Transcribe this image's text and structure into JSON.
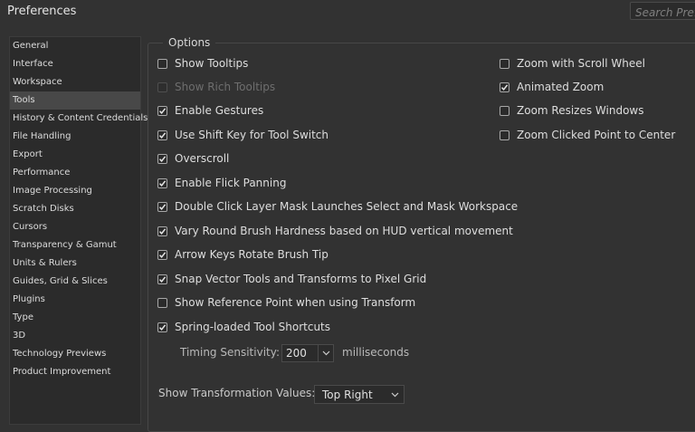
{
  "window": {
    "title": "Preferences"
  },
  "search": {
    "placeholder": "Search Preferences"
  },
  "sidebar": {
    "items": [
      {
        "label": "General"
      },
      {
        "label": "Interface"
      },
      {
        "label": "Workspace"
      },
      {
        "label": "Tools",
        "selected": true
      },
      {
        "label": "History & Content Credentials"
      },
      {
        "label": "File Handling"
      },
      {
        "label": "Export"
      },
      {
        "label": "Performance"
      },
      {
        "label": "Image Processing"
      },
      {
        "label": "Scratch Disks"
      },
      {
        "label": "Cursors"
      },
      {
        "label": "Transparency & Gamut"
      },
      {
        "label": "Units & Rulers"
      },
      {
        "label": "Guides, Grid & Slices"
      },
      {
        "label": "Plugins"
      },
      {
        "label": "Type"
      },
      {
        "label": "3D"
      },
      {
        "label": "Technology Previews"
      },
      {
        "label": "Product Improvement"
      }
    ]
  },
  "options": {
    "legend": "Options",
    "left": [
      {
        "label": "Show Tooltips",
        "checked": false
      },
      {
        "label": "Show Rich Tooltips",
        "checked": false,
        "disabled": true
      },
      {
        "label": "Enable Gestures",
        "checked": true
      },
      {
        "label": "Use Shift Key for Tool Switch",
        "checked": true
      },
      {
        "label": "Overscroll",
        "checked": true
      },
      {
        "label": "Enable Flick Panning",
        "checked": true
      },
      {
        "label": "Double Click Layer Mask Launches Select and Mask Workspace",
        "checked": true
      },
      {
        "label": "Vary Round Brush Hardness based on HUD vertical movement",
        "checked": true
      },
      {
        "label": "Arrow Keys Rotate Brush Tip",
        "checked": true
      },
      {
        "label": "Snap Vector Tools and Transforms to Pixel Grid",
        "checked": true
      },
      {
        "label": "Show Reference Point when using Transform",
        "checked": false
      },
      {
        "label": "Spring-loaded Tool Shortcuts",
        "checked": true
      }
    ],
    "right": [
      {
        "label": "Zoom with Scroll Wheel",
        "checked": false
      },
      {
        "label": "Animated Zoom",
        "checked": true
      },
      {
        "label": "Zoom Resizes Windows",
        "checked": false
      },
      {
        "label": "Zoom Clicked Point to Center",
        "checked": false
      }
    ]
  },
  "timing": {
    "label": "Timing Sensitivity:",
    "value": "200",
    "unit": "milliseconds"
  },
  "transform": {
    "label": "Show Transformation Values:",
    "value": "Top Right"
  },
  "colors": {
    "background": "#323232",
    "panel": "#2b2b2b",
    "selected_item": "#484848",
    "text": "#dedede",
    "disabled_text": "#6e6e6e"
  }
}
